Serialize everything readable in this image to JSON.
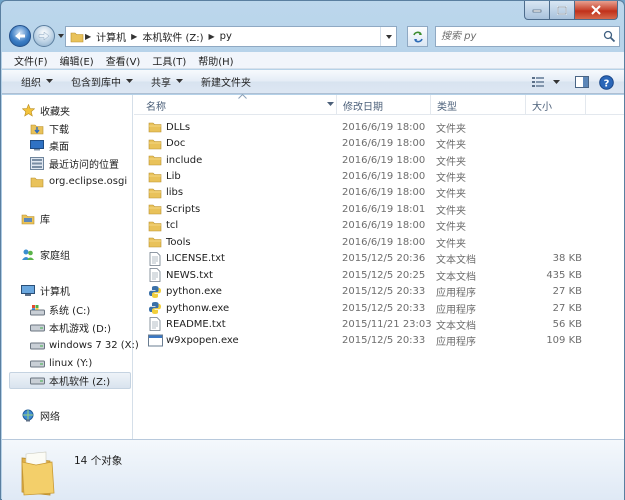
{
  "search": {
    "placeholder": "搜索 py"
  },
  "address": {
    "crumbs": [
      "计算机",
      "本机软件 (Z:)",
      "py"
    ]
  },
  "menu": [
    "文件(F)",
    "编辑(E)",
    "查看(V)",
    "工具(T)",
    "帮助(H)"
  ],
  "commands": {
    "organize": "组织",
    "include_in_library": "包含到库中",
    "share": "共享",
    "new_folder": "新建文件夹"
  },
  "nav": {
    "favorites": "收藏夹",
    "favorite_items": [
      "下载",
      "桌面",
      "最近访问的位置",
      "org.eclipse.osgi"
    ],
    "library": "库",
    "homegroup": "家庭组",
    "computer": "计算机",
    "drives": [
      "系统 (C:)",
      "本机游戏 (D:)",
      "windows 7 32 (X:)",
      "linux (Y:)",
      "本机软件 (Z:)"
    ],
    "network": "网络"
  },
  "columns": {
    "name": "名称",
    "date": "修改日期",
    "type": "类型",
    "size": "大小"
  },
  "files": [
    {
      "name": "DLLs",
      "date": "2016/6/19 18:00",
      "type": "文件夹",
      "size": "",
      "icon": "folder"
    },
    {
      "name": "Doc",
      "date": "2016/6/19 18:00",
      "type": "文件夹",
      "size": "",
      "icon": "folder"
    },
    {
      "name": "include",
      "date": "2016/6/19 18:00",
      "type": "文件夹",
      "size": "",
      "icon": "folder"
    },
    {
      "name": "Lib",
      "date": "2016/6/19 18:00",
      "type": "文件夹",
      "size": "",
      "icon": "folder"
    },
    {
      "name": "libs",
      "date": "2016/6/19 18:00",
      "type": "文件夹",
      "size": "",
      "icon": "folder"
    },
    {
      "name": "Scripts",
      "date": "2016/6/19 18:01",
      "type": "文件夹",
      "size": "",
      "icon": "folder"
    },
    {
      "name": "tcl",
      "date": "2016/6/19 18:00",
      "type": "文件夹",
      "size": "",
      "icon": "folder"
    },
    {
      "name": "Tools",
      "date": "2016/6/19 18:00",
      "type": "文件夹",
      "size": "",
      "icon": "folder"
    },
    {
      "name": "LICENSE.txt",
      "date": "2015/12/5 20:36",
      "type": "文本文档",
      "size": "38 KB",
      "icon": "text"
    },
    {
      "name": "NEWS.txt",
      "date": "2015/12/5 20:25",
      "type": "文本文档",
      "size": "435 KB",
      "icon": "text"
    },
    {
      "name": "python.exe",
      "date": "2015/12/5 20:33",
      "type": "应用程序",
      "size": "27 KB",
      "icon": "python"
    },
    {
      "name": "pythonw.exe",
      "date": "2015/12/5 20:33",
      "type": "应用程序",
      "size": "27 KB",
      "icon": "python"
    },
    {
      "name": "README.txt",
      "date": "2015/11/21 23:03",
      "type": "文本文档",
      "size": "56 KB",
      "icon": "text"
    },
    {
      "name": "w9xpopen.exe",
      "date": "2015/12/5 20:33",
      "type": "应用程序",
      "size": "109 KB",
      "icon": "exe"
    }
  ],
  "status": {
    "count": "14 个对象"
  }
}
